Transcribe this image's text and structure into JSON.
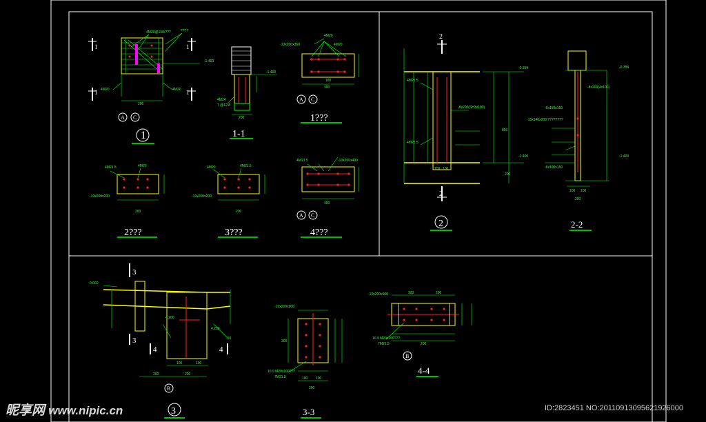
{
  "drawing": {
    "colors": {
      "frame": "#ffffff",
      "steel": "#ffff00",
      "dimension": "#00ff00",
      "bolt": "#ff2020",
      "weld": "#ff00ff",
      "hatch": "#00ff00"
    },
    "views": {
      "detail1": {
        "title": "1",
        "annotations": [
          "4M20@150/???",
          "????",
          "4M20",
          "4M20",
          "-1.400"
        ],
        "axis_markers": [
          "A",
          "C"
        ],
        "section_marks": [
          "1",
          "1",
          "1",
          "1"
        ],
        "dims": [
          "200"
        ]
      },
      "section1_1": {
        "title": "1-1",
        "annotations": [
          "4M24",
          "7 @12.8",
          "-1.400"
        ],
        "dims": [
          "200"
        ]
      },
      "view1": {
        "title": "1???",
        "annotations": [
          "-10x200x360",
          "4M20",
          "4M20"
        ],
        "axis_markers": [
          "A",
          "C"
        ],
        "dims": [
          "300",
          "180"
        ]
      },
      "view2": {
        "title": "2???",
        "annotations": [
          "4M21.5",
          "4M20",
          "-10x200x200"
        ],
        "dims": [
          "200"
        ]
      },
      "view3": {
        "title": "3???",
        "annotations": [
          "4M20",
          "4M21.5",
          "-10x200x200"
        ],
        "dims": [
          "200"
        ]
      },
      "view4": {
        "title": "4???",
        "annotations": [
          "4M21.5",
          "-10x200x400"
        ],
        "axis_markers": [
          "A",
          "C"
        ],
        "dims": [
          "300"
        ]
      },
      "detail2": {
        "title": "2",
        "annotations": [
          "-0.354",
          "4M21.5",
          "-8x200(SH3x100)",
          "4M21.5",
          "-1.400"
        ],
        "section_marks": [
          "2",
          "2"
        ],
        "dims": [
          "850",
          "200",
          "100",
          "100"
        ]
      },
      "section2_2": {
        "title": "2-2",
        "annotations": [
          "-0.354",
          "-8x200(4x100)",
          "-6x150x150",
          "-10x140x200 ????????",
          "-6x100x150",
          "-1.400"
        ],
        "dims": [
          "200",
          "100",
          "100"
        ]
      },
      "detail3": {
        "title": "3",
        "annotations": [
          "0.660",
          "4.200",
          "4.200",
          "-10"
        ],
        "axis_markers": [
          "B"
        ],
        "section_marks": [
          "3",
          "3",
          "4",
          "4"
        ],
        "dims": [
          "200",
          "200",
          "100",
          "100"
        ]
      },
      "section3_3": {
        "title": "3-3",
        "annotations": [
          "-10x200x200",
          "10.9 M20x100???",
          "7M21.5"
        ],
        "dims": [
          "200",
          "100",
          "100",
          "300"
        ]
      },
      "section4_4": {
        "title": "4-4",
        "annotations": [
          "-10x200x600",
          "10.9 M20x100???",
          "7M21.5"
        ],
        "axis_markers": [
          "B"
        ],
        "dims": [
          "300",
          "200",
          "200"
        ]
      }
    }
  },
  "watermark": {
    "left_brand": "昵享网",
    "left_url": "www.nipic.cn",
    "right_id": "ID:2823451 NO:20110913095621926000"
  }
}
